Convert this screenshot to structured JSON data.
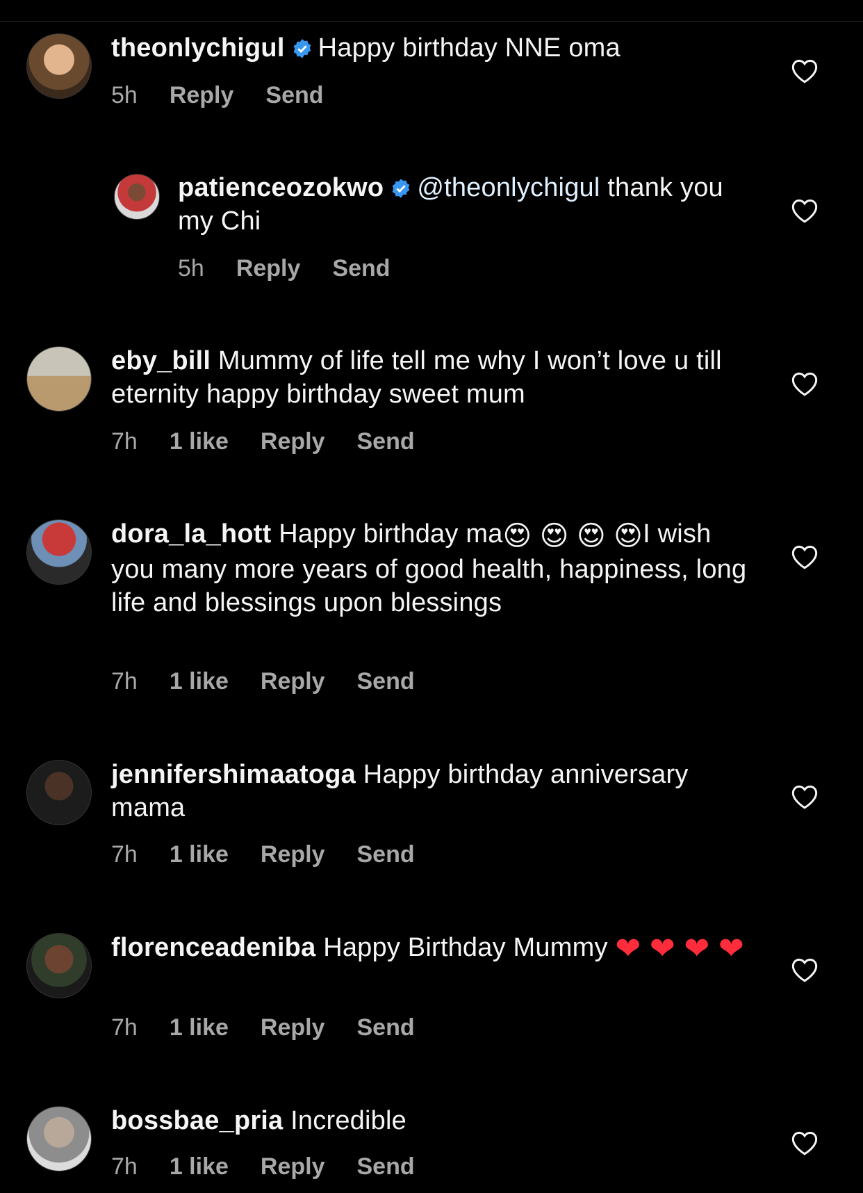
{
  "comments": [
    {
      "username": "theonlychigul",
      "verified": true,
      "text": "Happy birthday NNE oma",
      "time": "5h",
      "likes": "",
      "reply": "Reply",
      "send": "Send"
    },
    {
      "username": "patienceozokwo",
      "verified": true,
      "mention": "@theonlychigul",
      "text": " thank you my Chi",
      "time": "5h",
      "likes": "",
      "reply": "Reply",
      "send": "Send"
    },
    {
      "username": "eby_bill",
      "verified": false,
      "text": "Mummy of life tell me why I won’t love u till eternity happy birthday sweet mum",
      "time": "7h",
      "likes": "1 like",
      "reply": "Reply",
      "send": "Send"
    },
    {
      "username": "dora_la_hott",
      "verified": false,
      "text_before": "Happy birthday ma",
      "emojis": "😍 😍 😍 😍",
      "text_after": "I wish you many more years of good health, happiness, long life and blessings upon blessings",
      "time": "7h",
      "likes": "1 like",
      "reply": "Reply",
      "send": "Send"
    },
    {
      "username": "jennifershimaatoga",
      "verified": false,
      "text": "Happy birthday anniversary mama",
      "time": "7h",
      "likes": "1 like",
      "reply": "Reply",
      "send": "Send"
    },
    {
      "username": "florenceadeniba",
      "verified": false,
      "text": "Happy Birthday Mummy ",
      "hearts": "❤ ❤ ❤ ❤",
      "time": "7h",
      "likes": "1 like",
      "reply": "Reply",
      "send": "Send"
    },
    {
      "username": "bossbae_pria",
      "verified": false,
      "text": "Incredible",
      "time": "7h",
      "likes": "1 like",
      "reply": "Reply",
      "send": "Send"
    }
  ],
  "colors": {
    "background": "#000000",
    "text": "#f5f5f5",
    "meta": "#a8a8a8",
    "verified": "#3897f0",
    "heart_emoji": "#ff2d3b"
  },
  "icons": {
    "like": "heart-outline-icon",
    "verified": "verified-badge-icon"
  }
}
